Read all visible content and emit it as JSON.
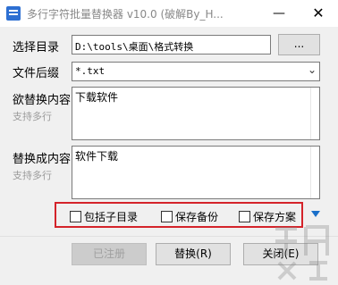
{
  "window": {
    "title": "多行字符批量替换器 v10.0 (破解By_H...",
    "minimize_symbol": "—",
    "close_symbol": "✕"
  },
  "form": {
    "directory": {
      "label": "选择目录",
      "value": "D:\\tools\\桌面\\格式转换",
      "browse_label": "..."
    },
    "extension": {
      "label": "文件后缀",
      "value": "*.txt",
      "arrow": "⌄"
    },
    "find": {
      "label": "欲替换内容",
      "hint": "支持多行",
      "value": "下载软件"
    },
    "replace": {
      "label": "替换成内容",
      "hint": "支持多行",
      "value": "软件下载"
    }
  },
  "options": {
    "include_subdirs": {
      "label": "包括子目录",
      "checked": false
    },
    "save_backup": {
      "label": "保存备份",
      "checked": false
    },
    "save_scheme": {
      "label": "保存方案",
      "checked": false
    }
  },
  "buttons": {
    "registered": "已注册",
    "replace": "替换(R)",
    "close": "关闭(E)"
  },
  "colors": {
    "highlight_border": "#d4232a",
    "expand_arrow": "#1a6fc9"
  }
}
